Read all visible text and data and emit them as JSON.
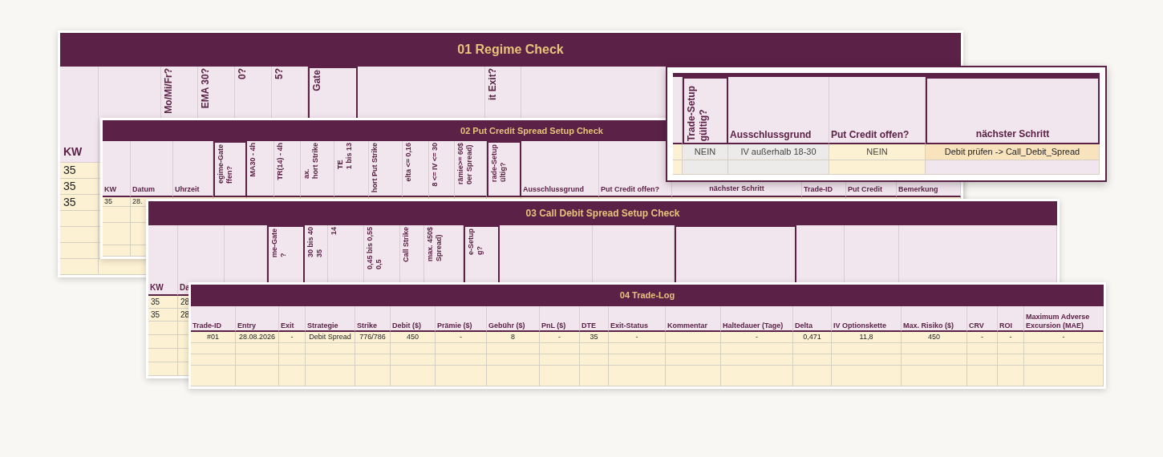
{
  "sheets": [
    {
      "title": "01 Regime Check",
      "columns": [
        {
          "label": "KW",
          "kind": "plain",
          "boxed": false
        },
        {
          "kind": "blank",
          "boxed": false
        },
        {
          "label": "Mo/Mi/Fr?",
          "kind": "rotated",
          "boxed": false
        },
        {
          "label": "EMA 30?",
          "kind": "rotated",
          "boxed": false
        },
        {
          "label": "0?",
          "kind": "rotated",
          "boxed": false
        },
        {
          "label": "5?",
          "kind": "rotated",
          "boxed": false
        },
        {
          "label": "Gate",
          "kind": "rotated",
          "boxed": true
        },
        {
          "kind": "blank",
          "boxed": false
        },
        {
          "label": "it Exit?",
          "kind": "rotated",
          "boxed": false
        },
        {
          "kind": "blank",
          "boxed": false
        }
      ],
      "rows": [
        [
          "35"
        ],
        [
          "35"
        ],
        [
          "35"
        ]
      ]
    },
    {
      "title": "02 Put Credit Spread Setup Check",
      "columns": [
        {
          "label": "KW",
          "kind": "plain",
          "boxed": false
        },
        {
          "label": "Datum",
          "kind": "plain",
          "boxed": false
        },
        {
          "label": "Uhrzeit",
          "kind": "plain",
          "boxed": false
        },
        {
          "label": "egime-Gate\nffen?",
          "kind": "rotated",
          "boxed": true
        },
        {
          "label": "MA30 - 4h",
          "kind": "rotated",
          "boxed": false
        },
        {
          "label": "TR(14) - 4h",
          "kind": "rotated",
          "boxed": false
        },
        {
          "label": "ax.\nhort Strike",
          "kind": "rotated",
          "boxed": false
        },
        {
          "label": "TE\n1 bis 13",
          "kind": "rotated",
          "boxed": false
        },
        {
          "label": "hort Put Strike",
          "kind": "rotated",
          "boxed": false
        },
        {
          "label": "elta <= 0,16",
          "kind": "rotated",
          "boxed": false
        },
        {
          "label": "8 <= IV <= 30",
          "kind": "rotated",
          "boxed": false
        },
        {
          "label": "rämie>= 60$\n0er Spread)",
          "kind": "rotated",
          "boxed": false
        },
        {
          "label": "rade-Setup\nültig?",
          "kind": "rotated",
          "boxed": true
        },
        {
          "label": "Ausschlussgrund",
          "kind": "plain",
          "boxed": false
        },
        {
          "label": "Put Credit offen?",
          "kind": "plain",
          "boxed": false
        },
        {
          "label": "nächster Schritt",
          "kind": "centered",
          "boxed": false
        },
        {
          "label": "Trade-ID",
          "kind": "plain",
          "boxed": false
        },
        {
          "label": "Put Credit",
          "kind": "plain",
          "boxed": false
        },
        {
          "label": "Bemerkung",
          "kind": "plain",
          "boxed": false
        }
      ],
      "rows": [
        [
          "35",
          "28."
        ]
      ]
    },
    {
      "title": "03 Call Debit Spread Setup Check",
      "columns": [
        {
          "label": "KW",
          "kind": "plain",
          "boxed": false
        },
        {
          "label": "Da",
          "kind": "plain",
          "boxed": false
        },
        {
          "kind": "blank",
          "boxed": false
        },
        {
          "label": "me-Gate\n?",
          "kind": "rotated",
          "boxed": true
        },
        {
          "label": "30 bis 40\n35",
          "kind": "rotated",
          "boxed": false
        },
        {
          "label": "14",
          "kind": "rotated",
          "boxed": false
        },
        {
          "label": "0,45 bis 0,55\n0,5",
          "kind": "rotated",
          "boxed": false
        },
        {
          "label": "Call Strike",
          "kind": "rotated",
          "boxed": false
        },
        {
          "label": "max. 450$\nSpread)",
          "kind": "rotated",
          "boxed": false
        },
        {
          "label": "e-Setup\ng?",
          "kind": "rotated",
          "boxed": true
        },
        {
          "kind": "blank",
          "boxed": false
        },
        {
          "kind": "blank",
          "boxed": false
        },
        {
          "kind": "blank",
          "boxed": true
        },
        {
          "kind": "blank",
          "boxed": false
        },
        {
          "kind": "blank",
          "boxed": false
        },
        {
          "kind": "blank",
          "boxed": false
        }
      ],
      "rows": [
        [
          "35",
          "28"
        ],
        [
          "35",
          "28"
        ]
      ]
    },
    {
      "title": "04 Trade-Log",
      "columns": [
        {
          "label": "Trade-ID",
          "kind": "plain",
          "boxed": false
        },
        {
          "label": "Entry",
          "kind": "plain",
          "boxed": false
        },
        {
          "label": "Exit",
          "kind": "plain",
          "boxed": false
        },
        {
          "label": "Strategie",
          "kind": "plain",
          "boxed": false
        },
        {
          "label": "Strike",
          "kind": "plain",
          "boxed": false
        },
        {
          "label": "Debit ($)",
          "kind": "plain",
          "boxed": false
        },
        {
          "label": "Prämie ($)",
          "kind": "plain",
          "boxed": false
        },
        {
          "label": "Gebühr ($)",
          "kind": "plain",
          "boxed": false
        },
        {
          "label": "PnL ($)",
          "kind": "plain",
          "boxed": false
        },
        {
          "label": "DTE",
          "kind": "plain",
          "boxed": false
        },
        {
          "label": "Exit-Status",
          "kind": "plain",
          "boxed": false
        },
        {
          "label": "Kommentar",
          "kind": "plain",
          "boxed": false
        },
        {
          "label": "Haltedauer (Tage)",
          "kind": "plain",
          "boxed": false
        },
        {
          "label": "Delta",
          "kind": "plain",
          "boxed": false
        },
        {
          "label": "IV Optionskette",
          "kind": "plain",
          "boxed": false
        },
        {
          "label": "Max. Risiko ($)",
          "kind": "plain",
          "boxed": false
        },
        {
          "label": "CRV",
          "kind": "plain",
          "boxed": false
        },
        {
          "label": "ROI",
          "kind": "plain",
          "boxed": false
        },
        {
          "label": "Maximum Adverse\nExcursion (MAE)",
          "kind": "plain",
          "boxed": false
        }
      ],
      "rows": [
        [
          "#01",
          "28.08.2026",
          "-",
          "Debit Spread",
          "776/786",
          "450",
          "-",
          "8",
          "-",
          "35",
          "-",
          null,
          "-",
          "0,471",
          "11,8",
          "450",
          "-",
          "-",
          "-"
        ]
      ]
    }
  ],
  "callout": {
    "columns": [
      {
        "kind": "blank",
        "boxed": false
      },
      {
        "label": "Trade-Setup\ngültig?",
        "kind": "rotated",
        "boxed": true
      },
      {
        "label": "Ausschlussgrund",
        "kind": "plain",
        "boxed": false
      },
      {
        "label": "Put Credit offen?",
        "kind": "plain",
        "boxed": false
      },
      {
        "label": "nächster Schritt",
        "kind": "centered",
        "boxed": true
      }
    ],
    "rows": [
      [
        {
          "kind": "plain"
        },
        {
          "text": "NEIN",
          "kind": "muted"
        },
        {
          "text": "IV außerhalb 18-30",
          "kind": "muted"
        },
        {
          "text": "NEIN",
          "kind": "plain"
        },
        {
          "text": "Debit prüfen -> Call_Debit_Spread",
          "kind": "highlight"
        }
      ],
      [
        {
          "kind": "plain"
        },
        {
          "kind": "muted"
        },
        {
          "kind": "muted"
        },
        {
          "kind": "plain"
        },
        {
          "kind": "lilac"
        }
      ]
    ]
  }
}
